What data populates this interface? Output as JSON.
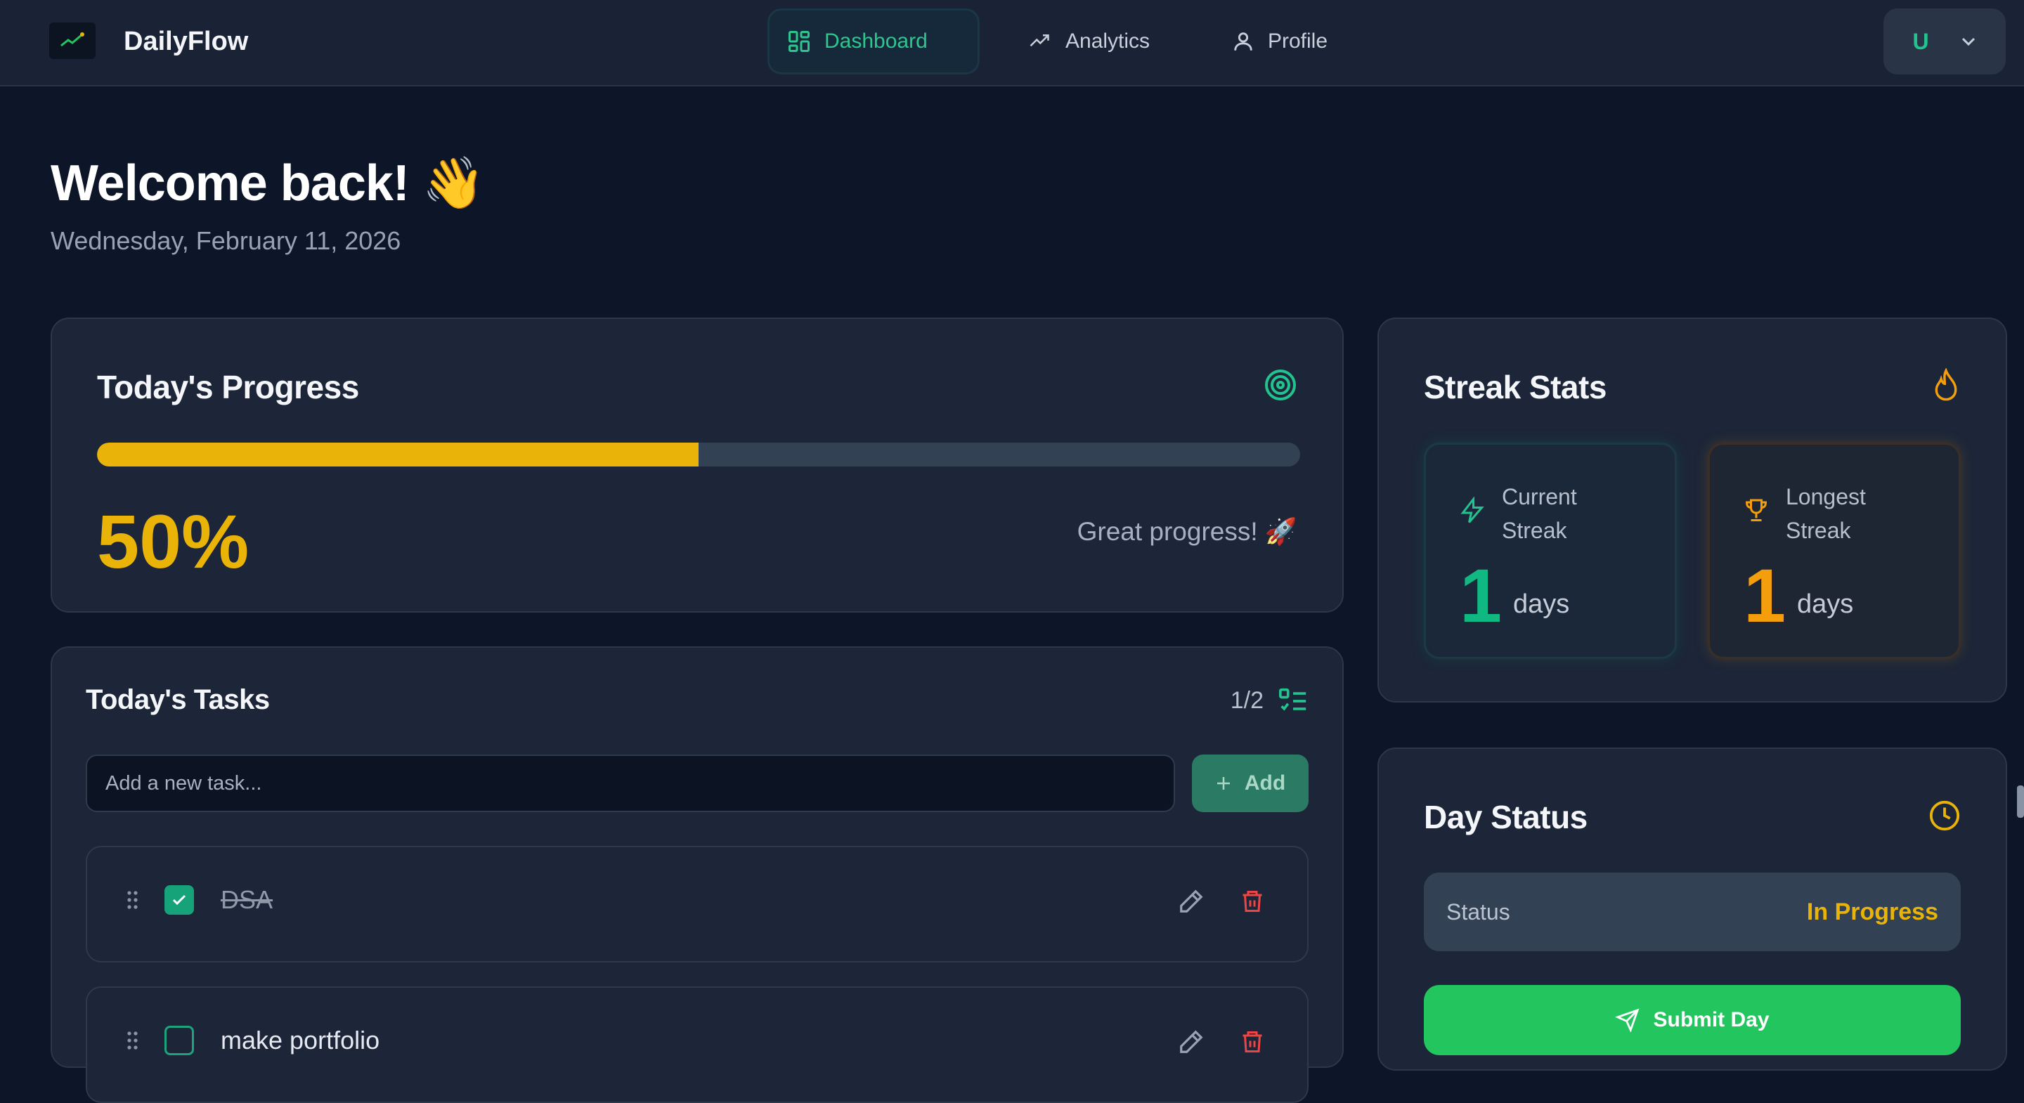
{
  "nav": {
    "brand": "DailyFlow",
    "tabs": [
      {
        "label": "Dashboard",
        "icon": "dashboard-icon",
        "active": true
      },
      {
        "label": "Analytics",
        "icon": "trending-up-icon",
        "active": false
      },
      {
        "label": "Profile",
        "icon": "user-icon",
        "active": false
      }
    ],
    "user_initial": "U"
  },
  "header": {
    "welcome": "Welcome back! 👋",
    "date": "Wednesday, February 11, 2026"
  },
  "progress": {
    "title": "Today's Progress",
    "value": 50,
    "percent_text": "50%",
    "message": "Great progress! 🚀"
  },
  "tasks": {
    "title": "Today's Tasks",
    "count": "1/2",
    "input_placeholder": "Add a new task...",
    "add_label": "Add",
    "items": [
      {
        "text": "DSA",
        "done": true
      },
      {
        "text": "make portfolio",
        "done": false
      }
    ]
  },
  "streak": {
    "title": "Streak Stats",
    "current": {
      "label": "Current Streak",
      "value": "1",
      "unit": "days"
    },
    "longest": {
      "label": "Longest Streak",
      "value": "1",
      "unit": "days"
    }
  },
  "day_status": {
    "title": "Day Status",
    "status_label": "Status",
    "status_value": "In Progress",
    "submit_label": "Submit Day"
  },
  "colors": {
    "accent_green": "#22c55e",
    "accent_yellow": "#eab308",
    "background": "#0d1528",
    "card": "#1c2638"
  }
}
